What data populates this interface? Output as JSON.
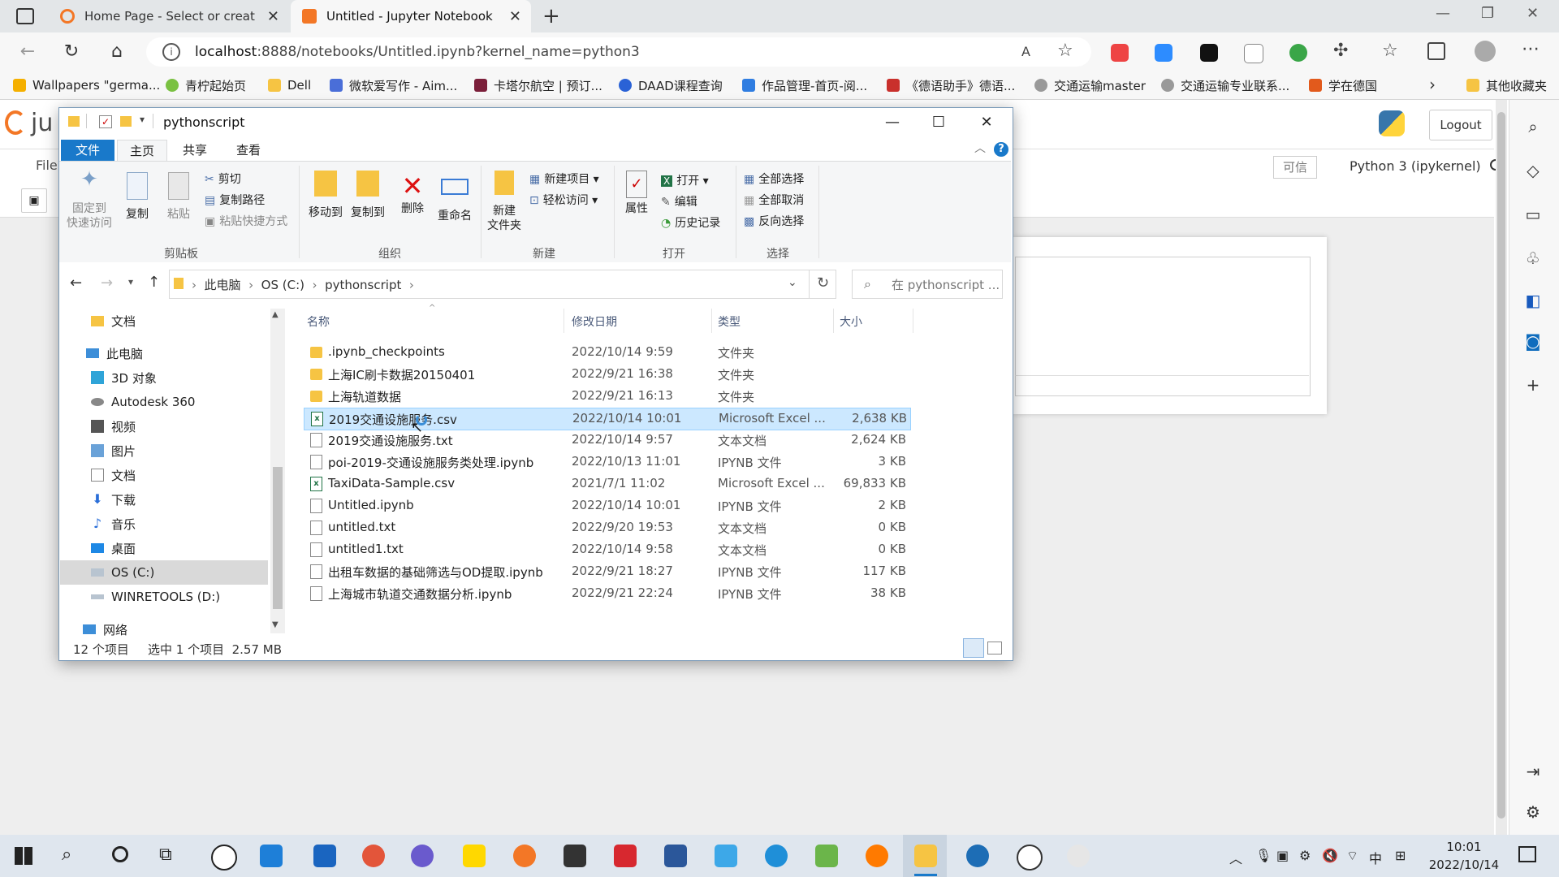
{
  "browser": {
    "tabs": [
      {
        "title": "Home Page - Select or create a n",
        "active": false
      },
      {
        "title": "Untitled - Jupyter Notebook",
        "active": true
      }
    ],
    "url_host": "localhost",
    "url_rest": ":8888/notebooks/Untitled.ipynb?kernel_name=python3",
    "bookmarks": [
      "Wallpapers \"germa...",
      "青柠起始页",
      "Dell",
      "微软爱写作 - Aim...",
      "卡塔尔航空 | 预订...",
      "DAAD课程查询",
      "作品管理-首页-阅...",
      "《德语助手》德语...",
      "交通运输master",
      "交通运输专业联系...",
      "学在德国"
    ],
    "other_bookmarks": "其他收藏夹"
  },
  "jupyter": {
    "logo_text": "ju",
    "menu_first": "File",
    "logout": "Logout",
    "trusted": "可信",
    "kernel": "Python 3 (ipykernel)"
  },
  "explorer": {
    "title": "pythonscript",
    "ribbon_tabs": [
      "文件",
      "主页",
      "共享",
      "查看"
    ],
    "clipboard": {
      "pin": "固定到\n快速访问",
      "copy": "复制",
      "paste": "粘贴",
      "cut": "剪切",
      "copy_path": "复制路径",
      "paste_shortcut": "粘贴快捷方式",
      "group": "剪贴板"
    },
    "organize": {
      "move_to": "移动到",
      "copy_to": "复制到",
      "delete": "删除",
      "rename": "重命名",
      "group": "组织"
    },
    "new": {
      "new_folder": "新建\n文件夹",
      "new_item": "新建项目",
      "easy_access": "轻松访问",
      "group": "新建"
    },
    "open": {
      "properties": "属性",
      "open": "打开",
      "edit": "编辑",
      "history": "历史记录",
      "group": "打开"
    },
    "select": {
      "select_all": "全部选择",
      "select_none": "全部取消",
      "invert": "反向选择",
      "group": "选择"
    },
    "path": [
      "此电脑",
      "OS (C:)",
      "pythonscript"
    ],
    "search_placeholder": "在 pythonscript ...",
    "tree": [
      {
        "label": "文档",
        "icon": "folder"
      },
      {
        "label": "此电脑",
        "icon": "pc"
      },
      {
        "label": "3D 对象",
        "icon": "cube"
      },
      {
        "label": "Autodesk 360",
        "icon": "cloud"
      },
      {
        "label": "视频",
        "icon": "video"
      },
      {
        "label": "图片",
        "icon": "picture"
      },
      {
        "label": "文档",
        "icon": "document"
      },
      {
        "label": "下载",
        "icon": "download"
      },
      {
        "label": "音乐",
        "icon": "music"
      },
      {
        "label": "桌面",
        "icon": "desktop"
      },
      {
        "label": "OS (C:)",
        "icon": "drive"
      },
      {
        "label": "WINRETOOLS (D:)",
        "icon": "drive"
      },
      {
        "label": "网络",
        "icon": "network"
      }
    ],
    "columns": [
      "名称",
      "修改日期",
      "类型",
      "大小"
    ],
    "files": [
      {
        "name": ".ipynb_checkpoints",
        "date": "2022/10/14 9:59",
        "type": "文件夹",
        "size": "",
        "icon": "folder"
      },
      {
        "name": "上海IC刷卡数据20150401",
        "date": "2022/9/21 16:38",
        "type": "文件夹",
        "size": "",
        "icon": "folder"
      },
      {
        "name": "上海轨道数据",
        "date": "2022/9/21 16:13",
        "type": "文件夹",
        "size": "",
        "icon": "folder"
      },
      {
        "name": "2019交通设施服务.csv",
        "date": "2022/10/14 10:01",
        "type": "Microsoft Excel ...",
        "size": "2,638 KB",
        "icon": "excel",
        "selected": true
      },
      {
        "name": "2019交通设施服务.txt",
        "date": "2022/10/14 9:57",
        "type": "文本文档",
        "size": "2,624 KB",
        "icon": "text"
      },
      {
        "name": "poi-2019-交通设施服务类处理.ipynb",
        "date": "2022/10/13 11:01",
        "type": "IPYNB 文件",
        "size": "3 KB",
        "icon": "file"
      },
      {
        "name": "TaxiData-Sample.csv",
        "date": "2021/7/1 11:02",
        "type": "Microsoft Excel ...",
        "size": "69,833 KB",
        "icon": "excel"
      },
      {
        "name": "Untitled.ipynb",
        "date": "2022/10/14 10:01",
        "type": "IPYNB 文件",
        "size": "2 KB",
        "icon": "file"
      },
      {
        "name": "untitled.txt",
        "date": "2022/9/20 19:53",
        "type": "文本文档",
        "size": "0 KB",
        "icon": "text"
      },
      {
        "name": "untitled1.txt",
        "date": "2022/10/14 9:58",
        "type": "文本文档",
        "size": "0 KB",
        "icon": "text"
      },
      {
        "name": "出租车数据的基础筛选与OD提取.ipynb",
        "date": "2022/9/21 18:27",
        "type": "IPYNB 文件",
        "size": "117 KB",
        "icon": "file"
      },
      {
        "name": "上海城市轨道交通数据分析.ipynb",
        "date": "2022/9/21 22:24",
        "type": "IPYNB 文件",
        "size": "38 KB",
        "icon": "file"
      }
    ],
    "status_count": "12 个项目",
    "status_selected": "选中 1 个项目  2.57 MB"
  },
  "taskbar": {
    "time": "10:01",
    "date": "2022/10/14",
    "ime": "中"
  },
  "colors": {
    "accent": "#1979ca",
    "selection": "#cce8ff",
    "folder": "#f6c443",
    "jupyter_orange": "#f37726"
  }
}
